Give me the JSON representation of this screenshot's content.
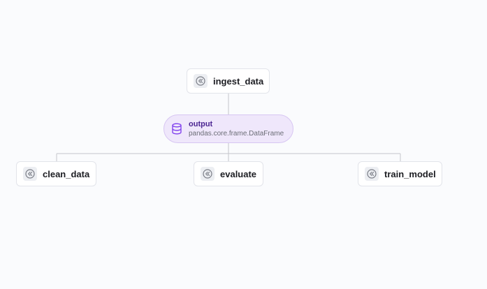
{
  "graph": {
    "steps": [
      {
        "id": "ingest",
        "label": "ingest_data",
        "icon": "step-icon"
      },
      {
        "id": "clean",
        "label": "clean_data",
        "icon": "step-icon"
      },
      {
        "id": "evaluate",
        "label": "evaluate",
        "icon": "step-icon"
      },
      {
        "id": "train",
        "label": "train_model",
        "icon": "step-icon"
      }
    ],
    "artifact": {
      "name": "output",
      "type": "pandas.core.frame.DataFrame",
      "icon": "database-icon"
    }
  },
  "colors": {
    "background": "#fafbfd",
    "node_border": "#e2e4ea",
    "artifact_fill": "#efe7fb",
    "artifact_border": "#d7c6f2",
    "artifact_accent": "#7c3aed",
    "edge": "#c4c6cc"
  }
}
